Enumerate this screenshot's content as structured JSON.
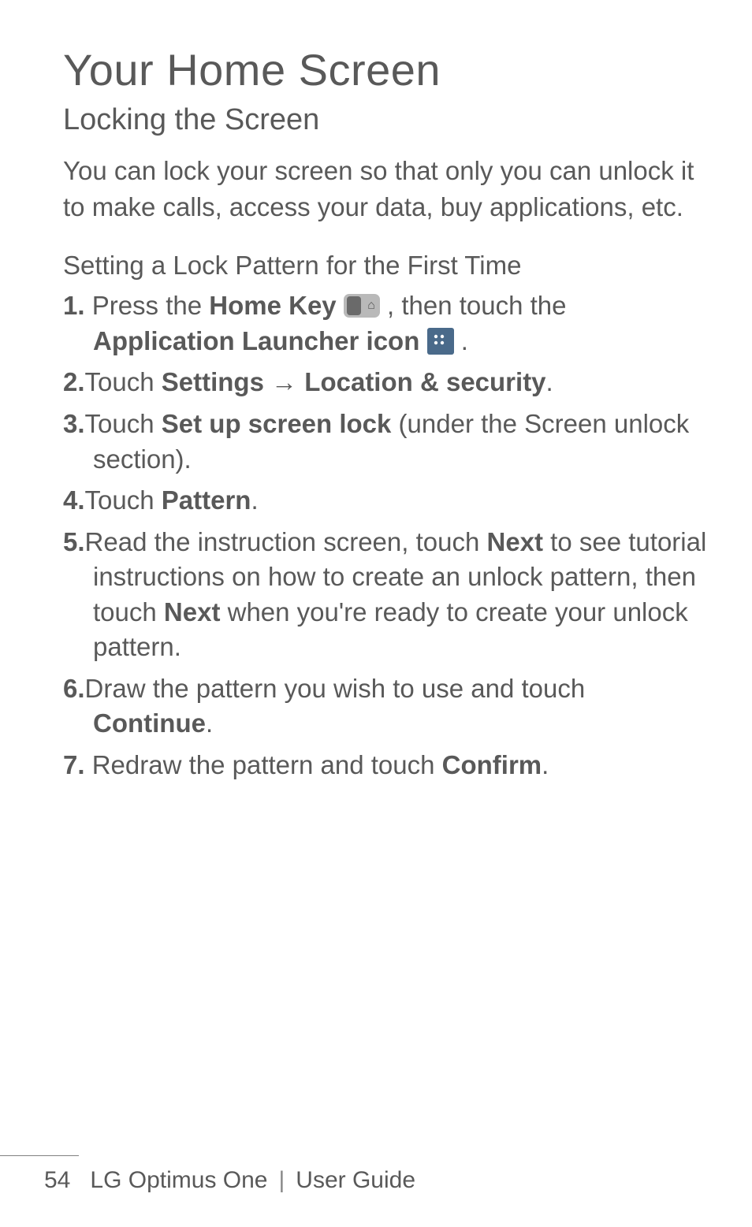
{
  "section_title": "Your Home Screen",
  "subsection": "Locking the Screen",
  "intro": "You can lock your screen so that only you can unlock it to make calls, access your data, buy applications, etc.",
  "step_heading": "Setting a Lock Pattern for the First Time",
  "steps": {
    "s1": {
      "num": "1.",
      "t1": " Press the ",
      "b1": "Home Key",
      "t2": " , then touch the ",
      "b2": "Application Launcher icon",
      "t3": " ."
    },
    "s2": {
      "num": "2.",
      "t1": "Touch ",
      "b1": "Settings",
      "arr": " → ",
      "b2": "Location & security",
      "t2": "."
    },
    "s3": {
      "num": "3.",
      "t1": "Touch ",
      "b1": "Set up screen lock",
      "t2": " (under the Screen unlock section)."
    },
    "s4": {
      "num": "4.",
      "t1": "Touch ",
      "b1": "Pattern",
      "t2": "."
    },
    "s5": {
      "num": "5.",
      "t1": "Read the instruction screen, touch ",
      "b1": "Next",
      "t2": " to see tutorial instructions on how to create an unlock pattern, then touch ",
      "b2": "Next",
      "t3": " when you're ready to create your unlock pattern."
    },
    "s6": {
      "num": "6.",
      "t1": "Draw the pattern you wish to use and touch ",
      "b1": "Continue",
      "t2": "."
    },
    "s7": {
      "num": "7.",
      "t1": " Redraw the pattern and touch ",
      "b1": "Confirm",
      "t2": "."
    }
  },
  "footer": {
    "page": "54",
    "product": "LG Optimus One",
    "divider": "|",
    "doc": "User Guide"
  }
}
